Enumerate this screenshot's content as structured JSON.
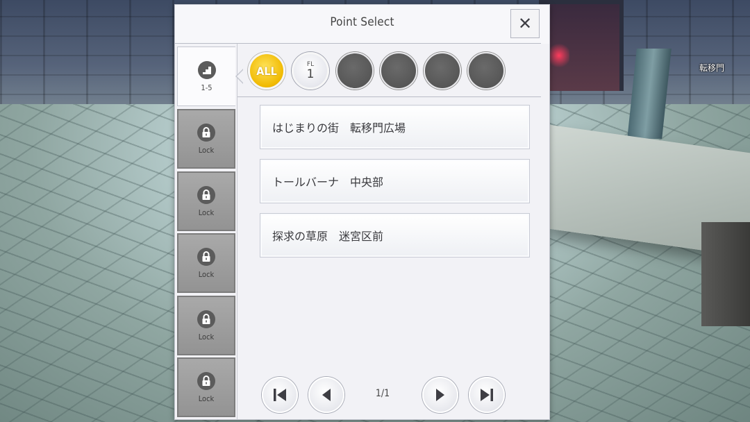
{
  "scene": {
    "location_label": "転移門"
  },
  "dialog": {
    "title": "Point Select",
    "close_label": "✕"
  },
  "tabs": [
    {
      "label": "1-5",
      "state": "active",
      "icon": "stairs-icon"
    },
    {
      "label": "Lock",
      "state": "locked",
      "icon": "lock-icon"
    },
    {
      "label": "Lock",
      "state": "locked",
      "icon": "lock-icon"
    },
    {
      "label": "Lock",
      "state": "locked",
      "icon": "lock-icon"
    },
    {
      "label": "Lock",
      "state": "locked",
      "icon": "lock-icon"
    },
    {
      "label": "Lock",
      "state": "locked",
      "icon": "lock-icon"
    }
  ],
  "filters": {
    "all_label": "ALL",
    "floor_prefix": "FL",
    "floor_number": "1",
    "empty_slots": 4
  },
  "points": [
    {
      "label": "はじまりの街　転移門広場"
    },
    {
      "label": "トールバーナ　中央部"
    },
    {
      "label": "探求の草原　迷宮区前"
    }
  ],
  "pagination": {
    "page_text": "1/1"
  },
  "colors": {
    "accent_gold": "#f0b900",
    "panel_bg": "#f2f2f6",
    "locked_tab": "#9d9d9d"
  }
}
